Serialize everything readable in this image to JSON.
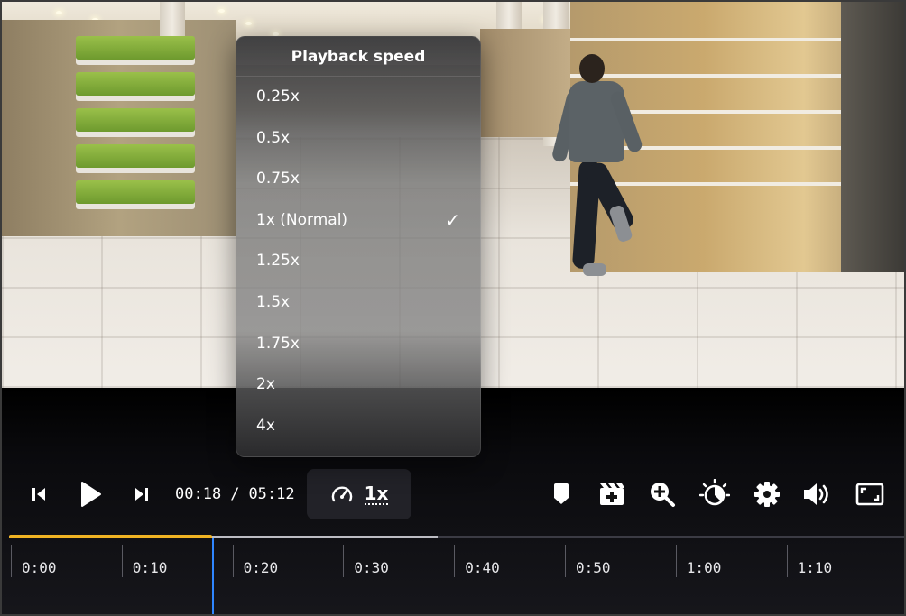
{
  "speed_menu": {
    "title": "Playback speed",
    "options": [
      {
        "label": "0.25x",
        "selected": false
      },
      {
        "label": "0.5x",
        "selected": false
      },
      {
        "label": "0.75x",
        "selected": false
      },
      {
        "label": "1x (Normal)",
        "selected": true
      },
      {
        "label": "1.25x",
        "selected": false
      },
      {
        "label": "1.5x",
        "selected": false
      },
      {
        "label": "1.75x",
        "selected": false
      },
      {
        "label": "2x",
        "selected": false
      },
      {
        "label": "4x",
        "selected": false
      }
    ],
    "check_glyph": "✓"
  },
  "player": {
    "current_time": "00:18",
    "time_separator": "/",
    "duration": "05:12",
    "speed_label": "1x"
  },
  "timeline": {
    "tick_labels": [
      "0:00",
      "0:10",
      "0:20",
      "0:30",
      "0:40",
      "0:50",
      "1:00",
      "1:10"
    ],
    "played_fraction": 0.227,
    "buffered_fraction": 0.479
  },
  "icons": {
    "prev_frame": "step-back-icon",
    "play": "play-icon",
    "next_frame": "step-forward-icon",
    "speed": "speedometer-icon",
    "bookmark": "bookmark-icon",
    "clip": "add-clip-icon",
    "zoom": "zoom-in-icon",
    "brightness": "brightness-icon",
    "settings": "gear-icon",
    "volume": "volume-icon",
    "fullscreen": "fullscreen-icon"
  },
  "colors": {
    "played": "#f0b323",
    "playhead": "#2f86ff",
    "buffered": "#bdbdc4"
  }
}
